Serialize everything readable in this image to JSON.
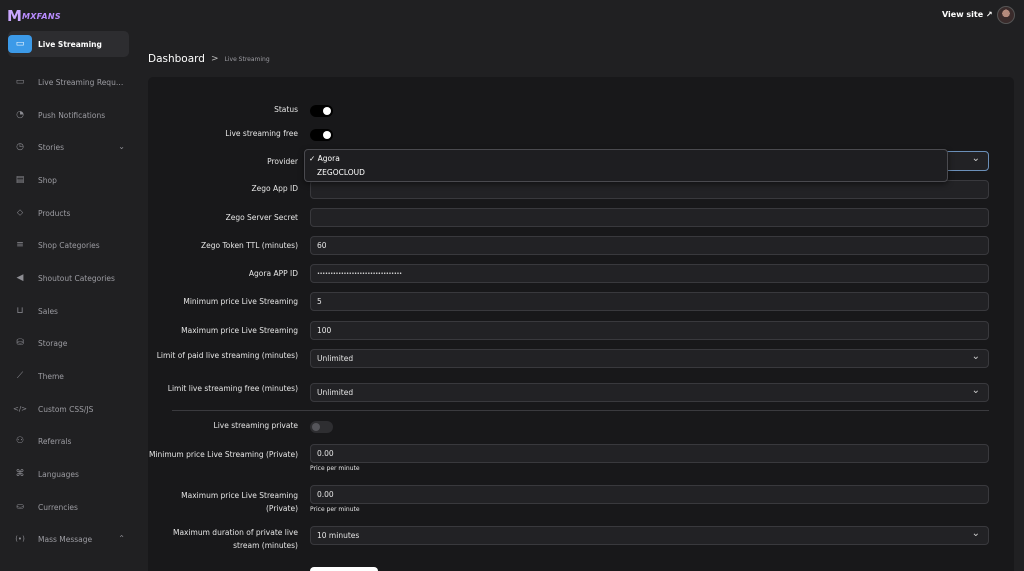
{
  "brand": {
    "logo_mark": "M",
    "logo_text": "MXFANS"
  },
  "header": {
    "view_site": "View site ↗"
  },
  "breadcrumb": {
    "root": "Dashboard",
    "sep": ">",
    "current": "Live Streaming"
  },
  "sidebar": {
    "items": [
      {
        "label": "Live Streaming",
        "icon": "▭"
      },
      {
        "label": "Live Streaming Request...",
        "icon": "▭"
      },
      {
        "label": "Push Notifications",
        "icon": "◔"
      },
      {
        "label": "Stories",
        "icon": "◷",
        "chevron": "⌄"
      },
      {
        "label": "Shop",
        "icon": "▤"
      },
      {
        "label": "Products",
        "icon": "⬦"
      },
      {
        "label": "Shop Categories",
        "icon": "≡"
      },
      {
        "label": "Shoutout Categories",
        "icon": "◀"
      },
      {
        "label": "Sales",
        "icon": "⊔"
      },
      {
        "label": "Storage",
        "icon": "⛁"
      },
      {
        "label": "Theme",
        "icon": "⟋"
      },
      {
        "label": "Custom CSS/JS",
        "icon": "</>"
      },
      {
        "label": "Referrals",
        "icon": "⚇"
      },
      {
        "label": "Languages",
        "icon": "⌘"
      },
      {
        "label": "Currencies",
        "icon": "⛀"
      },
      {
        "label": "Mass Message",
        "icon": "(•)",
        "chevron": "⌃"
      }
    ]
  },
  "form": {
    "status_label": "Status",
    "free_label": "Live streaming free",
    "provider_label": "Provider",
    "provider_options": [
      "✓ Agora",
      "ZEGOCLOUD"
    ],
    "zego_app_id_label": "Zego App ID",
    "zego_app_id_value": "",
    "zego_secret_label": "Zego Server Secret",
    "zego_secret_value": "",
    "zego_ttl_label": "Zego Token TTL (minutes)",
    "zego_ttl_value": "60",
    "agora_id_label": "Agora APP ID",
    "agora_id_value": "••••••••••••••••••••••••••••••••",
    "min_price_label": "Minimum price Live Streaming",
    "min_price_value": "5",
    "max_price_label": "Maximum price Live Streaming",
    "max_price_value": "100",
    "limit_paid_label": "Limit of paid live streaming (minutes)",
    "limit_paid_value": "Unlimited",
    "limit_free_label": "Limit live streaming free (minutes)",
    "limit_free_value": "Unlimited",
    "private_label": "Live streaming private",
    "min_private_label": "Minimum price Live Streaming (Private)",
    "min_private_value": "0.00",
    "min_private_hint": "Price per minute",
    "max_private_label": "Maximum price Live Streaming (Private)",
    "max_private_value": "0.00",
    "max_private_hint": "Price per minute",
    "max_duration_label": "Maximum duration of private live stream (minutes)",
    "max_duration_value": "10 minutes"
  },
  "colors": {
    "accent": "#3c9ae8",
    "brand": "#b98cff"
  }
}
